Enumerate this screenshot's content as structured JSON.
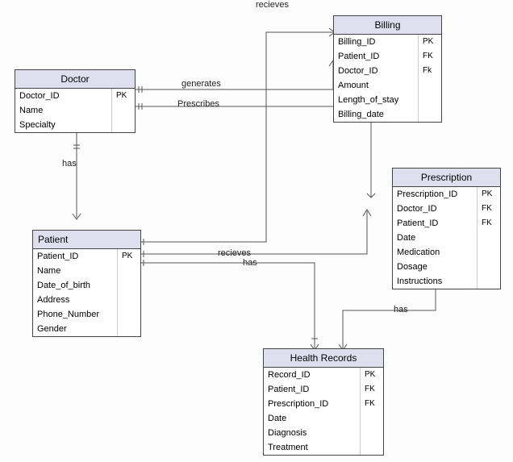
{
  "entities": {
    "doctor": {
      "title": "Doctor",
      "rows": [
        {
          "name": "Doctor_ID",
          "key": "PK"
        },
        {
          "name": "Name",
          "key": ""
        },
        {
          "name": "Specialty",
          "key": ""
        }
      ]
    },
    "patient": {
      "title": "Patient",
      "rows": [
        {
          "name": "Patient_ID",
          "key": "PK"
        },
        {
          "name": "Name",
          "key": ""
        },
        {
          "name": "Date_of_birth",
          "key": ""
        },
        {
          "name": "Address",
          "key": ""
        },
        {
          "name": "Phone_Number",
          "key": ""
        },
        {
          "name": "Gender",
          "key": ""
        }
      ]
    },
    "billing": {
      "title": "Billing",
      "rows": [
        {
          "name": "Billing_ID",
          "key": "PK"
        },
        {
          "name": "Patient_ID",
          "key": "FK"
        },
        {
          "name": "Doctor_ID",
          "key": "Fk"
        },
        {
          "name": "Amount",
          "key": ""
        },
        {
          "name": "Length_of_stay",
          "key": ""
        },
        {
          "name": "Billing_date",
          "key": ""
        }
      ]
    },
    "prescription": {
      "title": "Prescription",
      "rows": [
        {
          "name": "Prescription_ID",
          "key": "PK"
        },
        {
          "name": "Doctor_ID",
          "key": "FK"
        },
        {
          "name": "Patient_ID",
          "key": "FK"
        },
        {
          "name": "Date",
          "key": ""
        },
        {
          "name": "Medication",
          "key": ""
        },
        {
          "name": "Dosage",
          "key": ""
        },
        {
          "name": "Instructions",
          "key": ""
        }
      ]
    },
    "health": {
      "title": "Health Records",
      "rows": [
        {
          "name": "Record_ID",
          "key": "PK"
        },
        {
          "name": "Patient_ID",
          "key": "FK"
        },
        {
          "name": "Prescription_ID",
          "key": "FK"
        },
        {
          "name": "Date",
          "key": ""
        },
        {
          "name": "Diagnosis",
          "key": ""
        },
        {
          "name": "Treatment",
          "key": ""
        }
      ]
    }
  },
  "labels": {
    "generates": "generates",
    "prescribes": "Prescribes",
    "has1": "has",
    "recieves1": "recieves",
    "recieves2": "recieves",
    "has2": "has",
    "has3": "has"
  }
}
